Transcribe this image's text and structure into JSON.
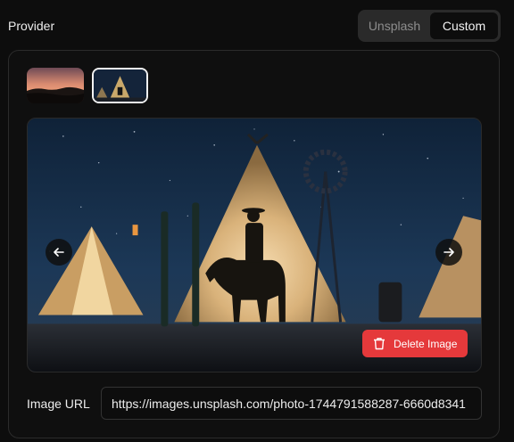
{
  "provider": {
    "label": "Provider",
    "options": [
      "Unsplash",
      "Custom"
    ],
    "selected": "Custom"
  },
  "gallery": {
    "thumbnails": [
      {
        "icon": "sunset-landscape-thumbnail",
        "selected": false
      },
      {
        "icon": "cowboy-night-thumbnail",
        "selected": true
      }
    ],
    "main_image_icon": "cowboy-teepee-night-scene",
    "prev_icon": "arrow-left-icon",
    "next_icon": "arrow-right-icon",
    "delete_label": "Delete Image",
    "delete_icon": "trash-icon"
  },
  "image_url": {
    "label": "Image URL",
    "value": "https://images.unsplash.com/photo-1744791588287-6660d8341"
  },
  "colors": {
    "background": "#0d0d0d",
    "card_border": "#2b2b2b",
    "delete": "#e5393b",
    "segment_bg": "#2a2a2a"
  }
}
